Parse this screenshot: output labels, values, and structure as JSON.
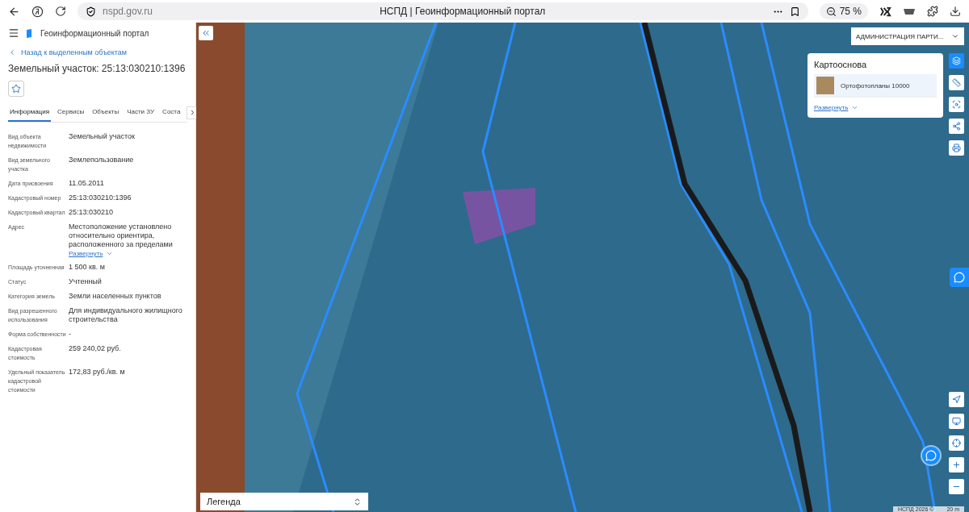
{
  "browser": {
    "url": "nspd.gov.ru",
    "title": "НСПД | Геоинформационный портал",
    "zoom": "75 %"
  },
  "sidebar": {
    "app_title": "Геоинформационный портал",
    "back_link": "Назад к выделенным объектам",
    "heading": "Земельный участок: 25:13:030210:1396",
    "favorite": false,
    "tabs": [
      {
        "label": "Информация",
        "selected": true
      },
      {
        "label": "Сервисы",
        "selected": false
      },
      {
        "label": "Объекты",
        "selected": false
      },
      {
        "label": "Части ЗУ",
        "selected": false
      },
      {
        "label": "Соста",
        "selected": false
      }
    ],
    "fields": [
      {
        "label": "Вид объекта недвижимости",
        "value": "Земельный участок"
      },
      {
        "label": "Вид земельного участка",
        "value": "Землепользование"
      },
      {
        "label": "Дата присвоения",
        "value": "11.05.2011"
      },
      {
        "label": "Кадастровый номер",
        "value": "25:13:030210:1396"
      },
      {
        "label": "Кадастровый квартал",
        "value": "25:13:030210"
      },
      {
        "label": "Адрес",
        "value": "Местоположение установлено относительно ориентира, расположенного за пределами",
        "expand": "Развернуть"
      },
      {
        "label": "Площадь уточненная",
        "value": "1 500 кв. м"
      },
      {
        "label": "Статус",
        "value": "Учтенный"
      },
      {
        "label": "Категория земель",
        "value": "Земли населенных пунктов"
      },
      {
        "label": "Вид разрешенного использования",
        "value": "Для индивидуального жилищного строительства"
      },
      {
        "label": "Форма собственности",
        "value": "-"
      },
      {
        "label": "Кадастровая стоимость",
        "value": "259 240,02 руб."
      },
      {
        "label": "Удельный показатель кадастровой стоимости",
        "value": "172,83 руб./кв. м"
      }
    ]
  },
  "map": {
    "org_select": "АДМИНИСТРАЦИЯ ПАРТИ...",
    "basemap": {
      "title": "Картооснова",
      "item": "Ортофотопланы 10000",
      "expand": "Развернуть"
    },
    "legend": "Легенда",
    "attribution": "НСПД 2026 ©",
    "scale": "20 m"
  }
}
